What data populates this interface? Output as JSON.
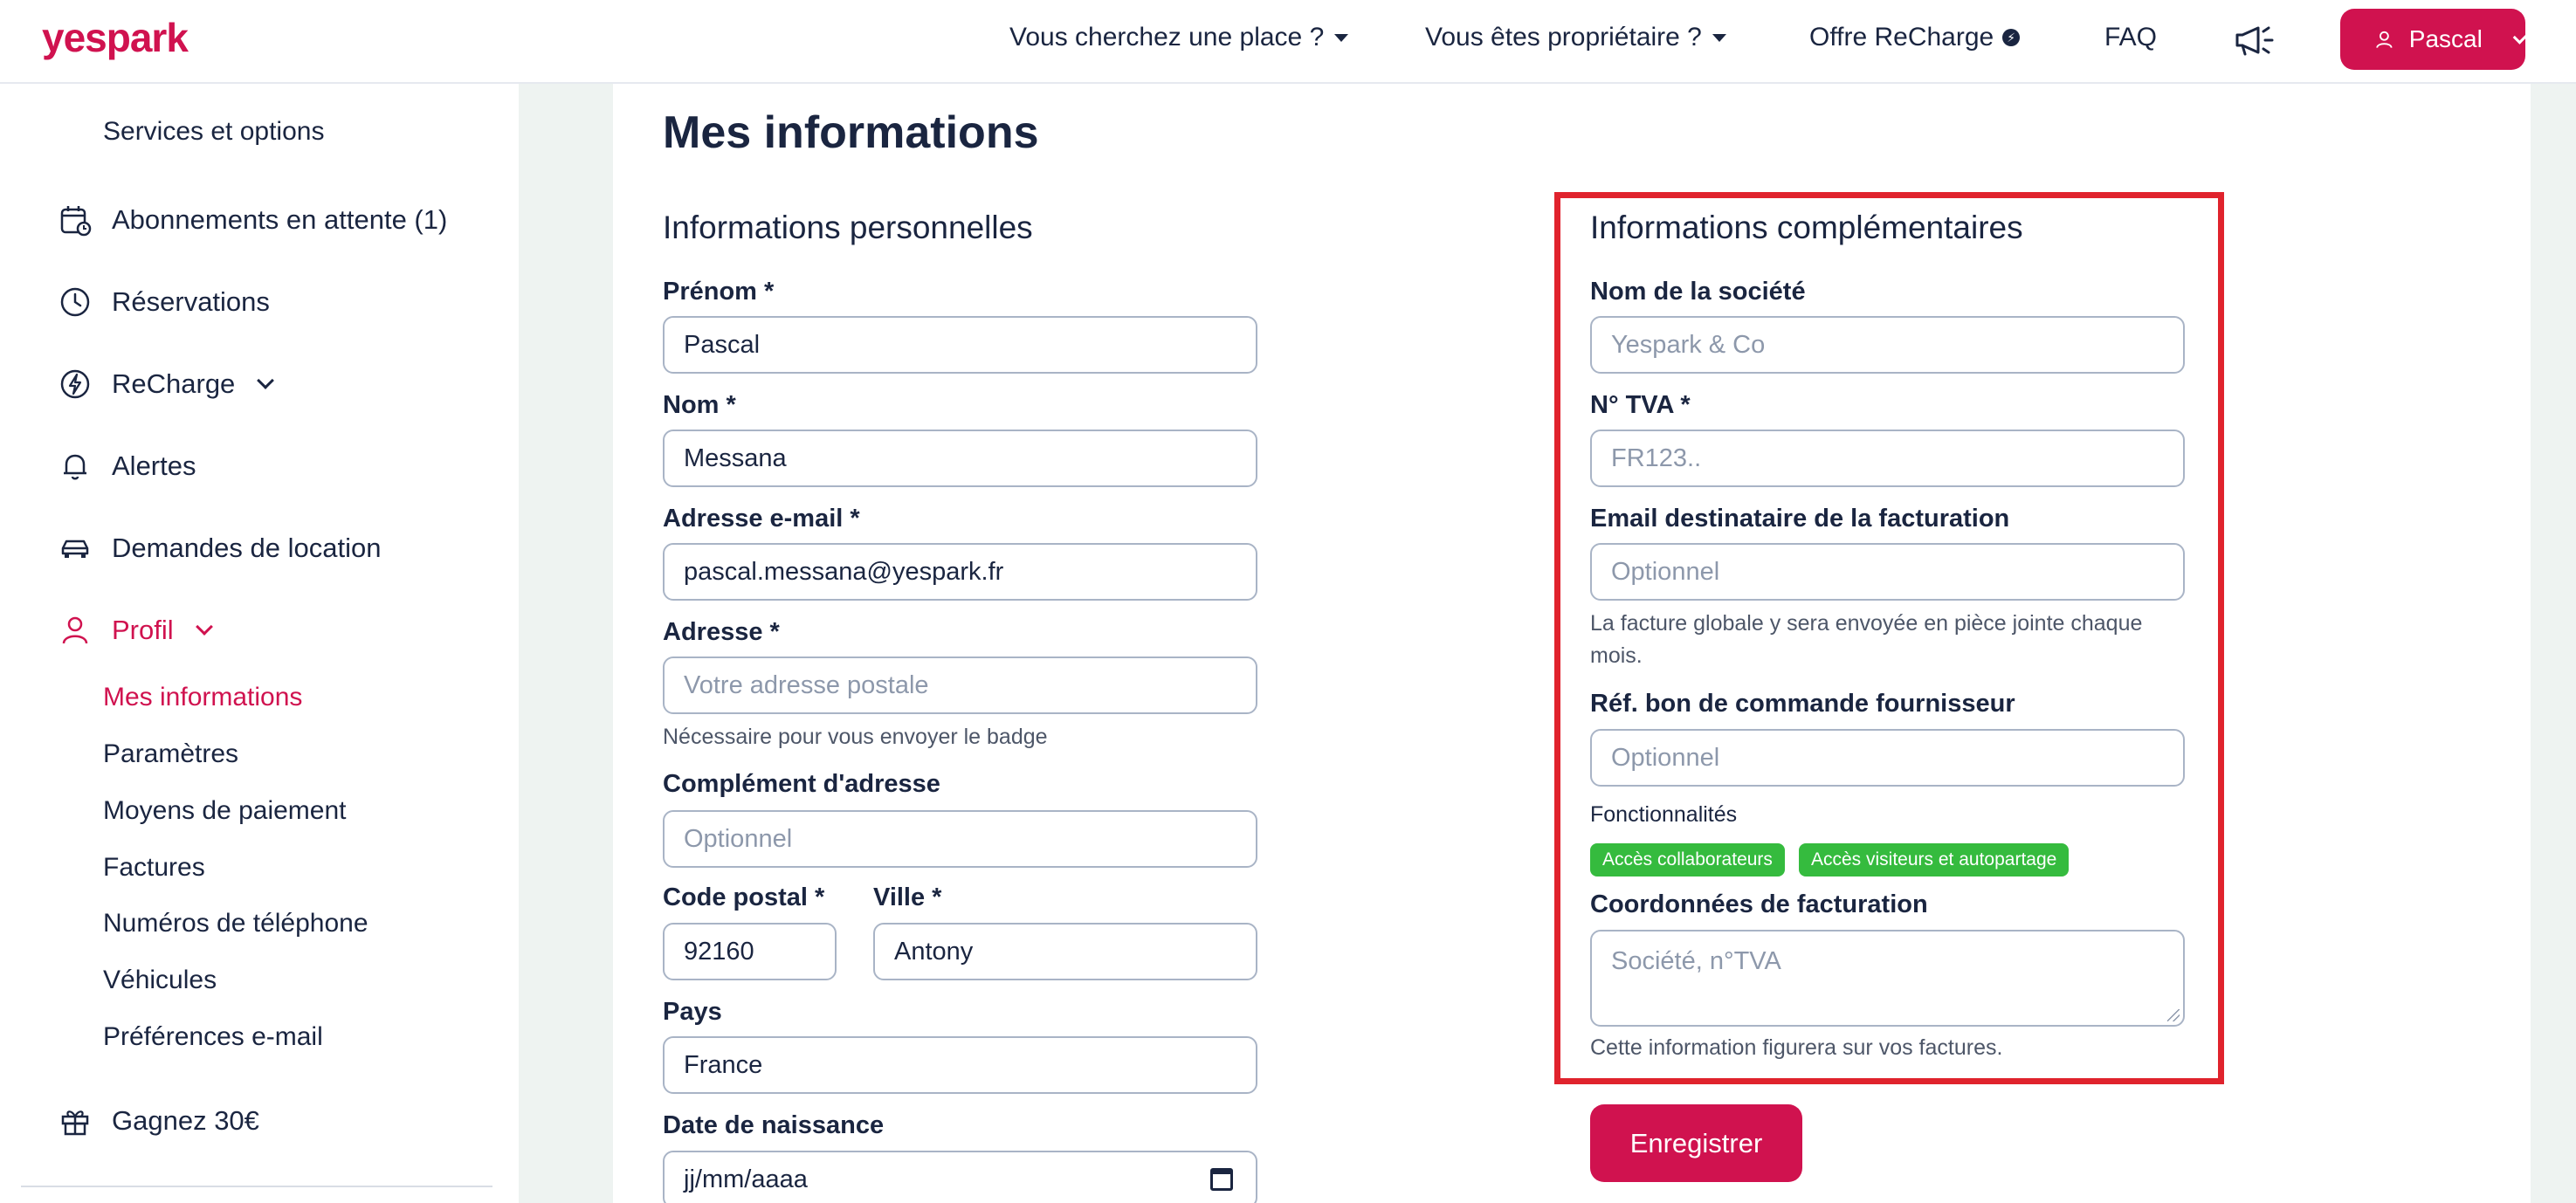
{
  "header": {
    "logo": "yespark",
    "nav": {
      "find_place": "Vous cherchez une place ?",
      "owner": "Vous êtes propriétaire ?",
      "recharge_offer": "Offre ReCharge",
      "faq": "FAQ"
    },
    "user_name": "Pascal"
  },
  "sidebar": {
    "truncated_above": "...",
    "services": "Services et options",
    "pending_subscriptions": "Abonnements en attente (1)",
    "reservations": "Réservations",
    "recharge": "ReCharge",
    "alerts": "Alertes",
    "rental_requests": "Demandes de location",
    "profile": "Profil",
    "profile_items": {
      "my_info": "Mes informations",
      "settings": "Paramètres",
      "payment": "Moyens de paiement",
      "invoices": "Factures",
      "phones": "Numéros de téléphone",
      "vehicles": "Véhicules",
      "email_prefs": "Préférences e-mail"
    },
    "referral": "Gagnez 30€"
  },
  "page": {
    "title": "Mes informations"
  },
  "personal": {
    "title": "Informations personnelles",
    "first_name": {
      "label": "Prénom *",
      "value": "Pascal"
    },
    "last_name": {
      "label": "Nom *",
      "value": "Messana"
    },
    "email": {
      "label": "Adresse e-mail *",
      "value": "pascal.messana@yespark.fr"
    },
    "address": {
      "label": "Adresse *",
      "placeholder": "Votre adresse postale",
      "helper": "Nécessaire pour vous envoyer le badge"
    },
    "address_extra": {
      "label": "Complément d'adresse",
      "placeholder": "Optionnel"
    },
    "postal_code": {
      "label": "Code postal *",
      "value": "92160"
    },
    "city": {
      "label": "Ville *",
      "value": "Antony"
    },
    "country": {
      "label": "Pays",
      "value": "France"
    },
    "birth_date": {
      "label": "Date de naissance",
      "placeholder": "jj/mm/aaaa"
    }
  },
  "complementary": {
    "title": "Informations complémentaires",
    "company": {
      "label": "Nom de la société",
      "placeholder": "Yespark & Co"
    },
    "vat": {
      "label": "N° TVA *",
      "placeholder": "FR123.."
    },
    "billing_email": {
      "label": "Email destinataire de la facturation",
      "placeholder": "Optionnel",
      "helper": "La facture globale y sera envoyée en pièce jointe chaque mois."
    },
    "po_ref": {
      "label": "Réf. bon de commande fournisseur",
      "placeholder": "Optionnel"
    },
    "features": {
      "label": "Fonctionnalités",
      "tags": [
        "Accès collaborateurs",
        "Accès visiteurs et autopartage"
      ]
    },
    "billing_details": {
      "label": "Coordonnées de facturation",
      "placeholder": "Société, n°TVA",
      "helper": "Cette information figurera sur vos factures."
    }
  },
  "actions": {
    "save": "Enregistrer"
  },
  "colors": {
    "brand": "#d0124f",
    "highlight": "#e0232d",
    "tag_green": "#35bb3e"
  }
}
